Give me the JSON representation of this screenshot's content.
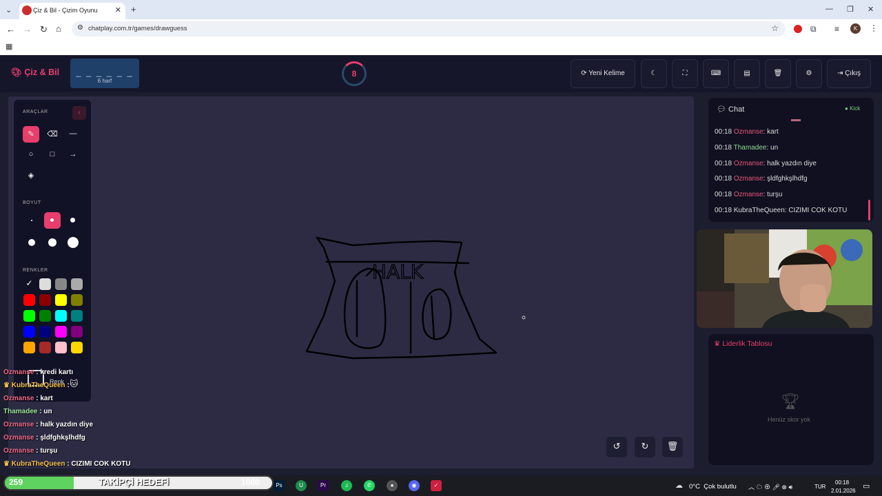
{
  "browser": {
    "tab_title": "Çiz & Bil - Çizim Oyunu",
    "url": "chatplay.com.tr/games/drawguess",
    "profile_initial": "K"
  },
  "app": {
    "logo": "Çiz & Bil",
    "word_mask": "_ _ _ _ _ _",
    "word_length": "6 harf",
    "timer": "8",
    "buttons": {
      "new_word": "Yeni Kelime",
      "logout": "Çıkış"
    }
  },
  "tools": {
    "title": "ARAÇLAR",
    "size_title": "BOYUT",
    "colors_title": "RENKLER",
    "custom_color_label": "Renk",
    "colors": [
      "#ffffff",
      "#dddddd",
      "#888888",
      "#aaaaaa",
      "#ff0000",
      "#8b0000",
      "#ffff00",
      "#808000",
      "#00ff00",
      "#008000",
      "#00ffff",
      "#008080",
      "#0000ff",
      "#000080",
      "#ff00ff",
      "#800080",
      "#ffa500",
      "#a52a2a",
      "#ffc0cb",
      "#ffd700"
    ]
  },
  "drawing": {
    "text": "HALK"
  },
  "chat": {
    "title": "Chat",
    "platform": "Kick",
    "messages": [
      {
        "time": "00:18",
        "user": "Ozmanse",
        "text": ": kart",
        "color": "pink"
      },
      {
        "time": "00:18",
        "user": "Thamadee",
        "text": ": un",
        "color": "green"
      },
      {
        "time": "00:18",
        "user": "Ozmanse",
        "text": ": halk yazdın diye",
        "color": "pink"
      },
      {
        "time": "00:18",
        "user": "Ozmanse",
        "text": ": şldfghkşlhdfg",
        "color": "pink"
      },
      {
        "time": "00:18",
        "user": "Ozmanse",
        "text": ": turşu",
        "color": "pink"
      },
      {
        "time": "00:18",
        "user": "KubraTheQueen",
        "text": ": CIZIMI COK KOTU",
        "color": "plain"
      }
    ]
  },
  "leaderboard": {
    "title": "Liderlik Tablosu",
    "empty": "Henüz skor yok"
  },
  "overlay_chat": [
    {
      "user": "Ozmanse",
      "text": " : kredi kartı"
    },
    {
      "user": "KubraTheQueen",
      "text": " : "
    },
    {
      "user": "Ozmanse",
      "text": " : kart"
    },
    {
      "user": "Thamadee",
      "text": " : un"
    },
    {
      "user": "Ozmanse",
      "text": " : halk yazdın diye"
    },
    {
      "user": "Ozmanse",
      "text": " : şldfghkşlhdfg"
    },
    {
      "user": "Ozmanse",
      "text": " : turşu"
    },
    {
      "user": "KubraTheQueen",
      "text": " : CIZIMI COK KOTU"
    }
  ],
  "stream": {
    "follower_count": "259",
    "goal_label": "TAKİPÇİ HEDEFİ",
    "goal_target": "1000",
    "goal_progress": 0.259
  },
  "taskbar": {
    "weather": "0°C  Çok bulutlu",
    "lang": "TUR",
    "time": "00:18",
    "date": "2.01.2026"
  }
}
